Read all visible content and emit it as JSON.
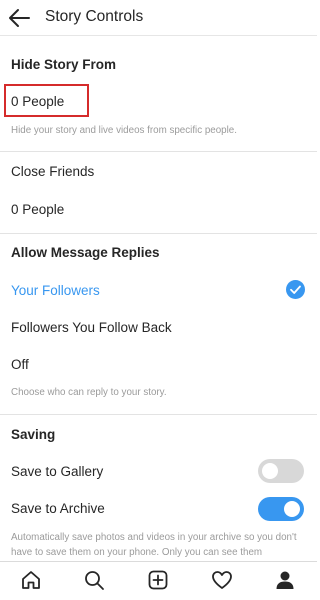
{
  "header": {
    "title": "Story Controls",
    "back_icon": "back-arrow-icon"
  },
  "hide_story": {
    "title": "Hide Story From",
    "value": "0 People",
    "helper": "Hide your story and live videos from specific people."
  },
  "close_friends": {
    "title": "Close Friends",
    "value": "0 People"
  },
  "message_replies": {
    "title": "Allow Message Replies",
    "options": [
      "Your Followers",
      "Followers You Follow Back",
      "Off"
    ],
    "selected": "Your Followers",
    "helper": "Choose who can reply to your story."
  },
  "saving": {
    "title": "Saving",
    "save_to_gallery": {
      "label": "Save to Gallery",
      "enabled": false
    },
    "save_to_archive": {
      "label": "Save to Archive",
      "enabled": true
    },
    "helper": "Automatically save photos and videos in your archive so you don't have to save them on your phone. Only you can see them"
  },
  "tabbar": {
    "icons": [
      "home-icon",
      "search-icon",
      "add-post-icon",
      "heart-icon",
      "profile-icon"
    ]
  },
  "colors": {
    "accent": "#3897f0",
    "highlight": "#d52b2b",
    "toggle_off": "#d8d8d8"
  }
}
